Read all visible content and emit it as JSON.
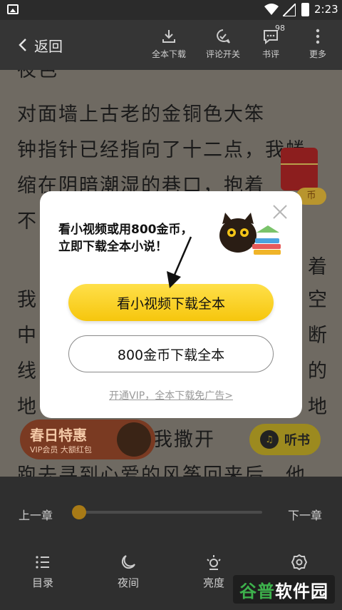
{
  "status_bar": {
    "time": "2:23"
  },
  "top_bar": {
    "back_label": "返回",
    "tools": [
      {
        "label": "全本下载",
        "icon": "download-icon"
      },
      {
        "label": "评论开关",
        "icon": "comment-toggle-icon"
      },
      {
        "label": "书评",
        "icon": "review-icon",
        "badge": "98"
      },
      {
        "label": "更多",
        "icon": "more-icon"
      }
    ]
  },
  "reader": {
    "lines": [
      "夜色",
      "    对面墙上古老的金铜色大笨",
      "钟指针已经指向了十二点，我蜷",
      "缩在阴暗潮湿的巷口，抱着",
      "不",
      "着",
      "我",
      "空",
      "中",
      "断",
      "线",
      "的",
      "地",
      "地",
      "的我撒开",
      "跑去寻到心爱的风筝回来后，他"
    ]
  },
  "promos": {
    "coin_tag": "币",
    "spring_title": "春日特惠",
    "spring_sub": "VIP会员 大额红包",
    "listen_label": "听书"
  },
  "modal": {
    "message_line1": "看小视频或用800金币，",
    "message_line2": "立即下载全本小说！",
    "primary_button": "看小视频下载全本",
    "secondary_button": "800金币下载全本",
    "vip_link": "开通VIP，全本下载免广告>"
  },
  "bottom": {
    "prev_chapter": "上一章",
    "next_chapter": "下一章",
    "progress": 0.0,
    "nav": [
      {
        "label": "目录",
        "icon": "catalog-icon"
      },
      {
        "label": "夜间",
        "icon": "night-mode-icon"
      },
      {
        "label": "亮度",
        "icon": "brightness-icon"
      },
      {
        "label": "设置",
        "icon": "settings-icon"
      }
    ]
  },
  "watermark": {
    "prefix": "谷普",
    "suffix": "软件园"
  }
}
